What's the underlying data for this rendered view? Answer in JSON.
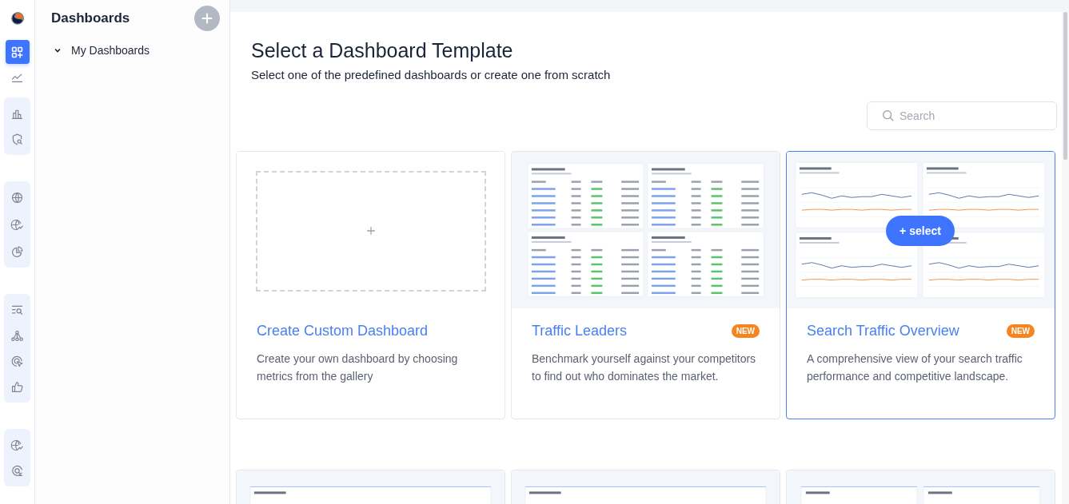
{
  "rail": {
    "items": [
      {
        "kind": "dashboards",
        "selected": true
      },
      {
        "kind": "trend",
        "selected": false
      }
    ],
    "groups": [
      {
        "items": [
          {
            "kind": "bars",
            "selected": false
          },
          {
            "kind": "shield-search",
            "selected": false
          }
        ]
      },
      {
        "items": [
          {
            "kind": "globe",
            "selected": false
          },
          {
            "kind": "globe-trend",
            "selected": false
          },
          {
            "kind": "pie",
            "selected": false
          }
        ]
      },
      {
        "items": [
          {
            "kind": "list-search",
            "selected": false
          },
          {
            "kind": "hierarchy",
            "selected": false
          },
          {
            "kind": "cursor",
            "selected": false
          },
          {
            "kind": "thumbs-up",
            "selected": false
          }
        ]
      },
      {
        "items": [
          {
            "kind": "globe-trend",
            "selected": false
          },
          {
            "kind": "search-circle",
            "selected": false
          }
        ]
      }
    ]
  },
  "sidebar": {
    "title": "Dashboards",
    "tree": [
      {
        "label": "My Dashboards",
        "expanded": true
      }
    ]
  },
  "main": {
    "title": "Select a Dashboard Template",
    "subtitle": "Select one of the predefined dashboards or create one from scratch",
    "search": {
      "placeholder": "Search"
    },
    "cards": [
      {
        "kind": "custom",
        "title": "Create Custom Dashboard",
        "description": "Create your own dashboard by choosing metrics from the gallery",
        "selected": false
      },
      {
        "kind": "tables",
        "title": "Traffic Leaders",
        "badge": "NEW",
        "description": "Benchmark yourself against your competitors to find out who dominates the market.",
        "selected": false
      },
      {
        "kind": "lines",
        "title": "Search Traffic Overview",
        "badge": "NEW",
        "description": "A comprehensive view of your search traffic performance and competitive landscape.",
        "selected": true,
        "select_button": "+ select"
      },
      {
        "kind": "single",
        "selected": false
      },
      {
        "kind": "single",
        "selected": false
      },
      {
        "kind": "double",
        "selected": false
      }
    ]
  }
}
